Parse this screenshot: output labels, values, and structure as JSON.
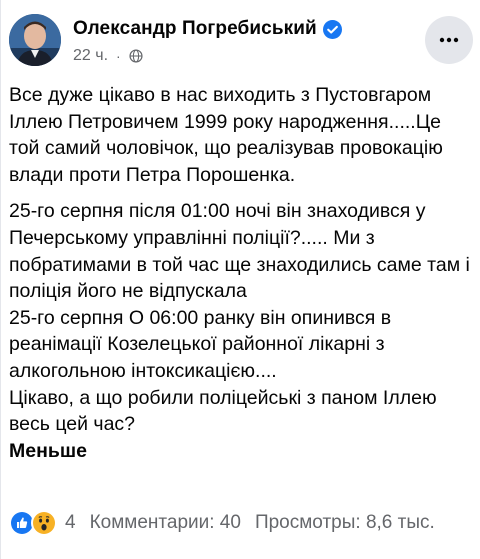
{
  "post": {
    "author": "Олександр Погребиський",
    "timestamp": "22 ч.",
    "separator": "·",
    "paragraphs": [
      "Все дуже цікаво в нас виходить з Пустовгаром Іллею Петровичем 1999 року народження.....Це той самий чоловічок, що реалізував провокацію влади проти Петра Порошенка.",
      "25-го серпня після 01:00 ночі він знаходився у Печерському управлінні поліції?..... Ми з побратимами в той час ще знаходились саме там і поліція його не відпускала",
      "25-го серпня О 06:00 ранку він опинився в реанімації Козелецької районної лікарні з алкогольною інтоксикацією....",
      "Цікаво, а що робили поліцейські з паном Іллею весь цей час?"
    ],
    "less_label": "Меньше"
  },
  "footer": {
    "reaction_count": "4",
    "comments": "Комментарии: 40",
    "views": "Просмотры: 8,6 тыс."
  },
  "icons": {
    "verified": "verified-badge-icon",
    "audience": "globe-icon",
    "more": "more-horizontal-icon",
    "reaction_like": "like-reaction-icon",
    "reaction_wow": "wow-reaction-icon"
  },
  "colors": {
    "text_primary": "#050505",
    "text_secondary": "#65676b",
    "verified_blue": "#1877f2",
    "more_button_bg": "#e4e6eb",
    "wow_yellow": "#f7b125"
  }
}
